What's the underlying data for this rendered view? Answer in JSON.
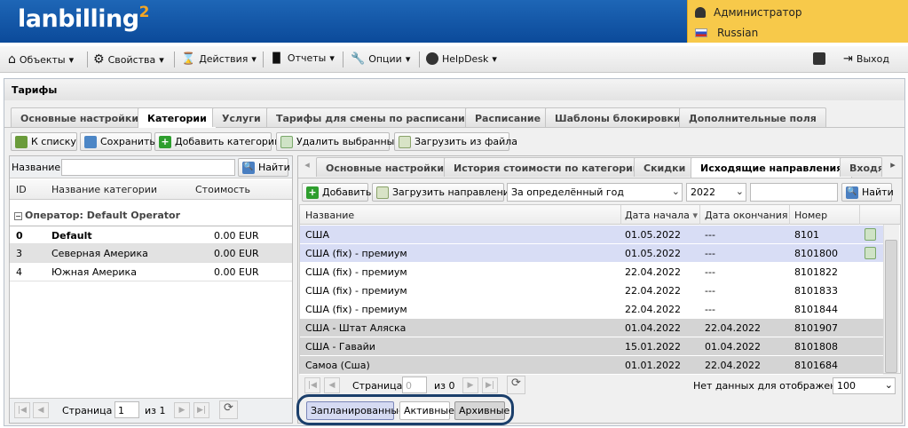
{
  "header": {
    "logo": "lanbilling",
    "logo_sup": "2",
    "user": "Администратор",
    "language": "Russian"
  },
  "menu": {
    "items": [
      "Объекты",
      "Свойства",
      "Действия",
      "Отчеты",
      "Опции",
      "HelpDesk"
    ],
    "logout": "Выход"
  },
  "page": {
    "title": "Тарифы"
  },
  "main_tabs": [
    "Основные настройки",
    "Категории",
    "Услуги",
    "Тарифы для смены по расписанию",
    "Расписание",
    "Шаблоны блокировки",
    "Дополнительные поля"
  ],
  "toolbar": {
    "back": "К списку",
    "save": "Сохранить",
    "add_category": "Добавить категорию",
    "delete_selected": "Удалить выбранные",
    "load_file": "Загрузить из файла"
  },
  "left": {
    "name_label": "Название:",
    "find": "Найти",
    "columns": [
      "ID",
      "Название категории",
      "Стоимость"
    ],
    "group": "Оператор: Default Operator",
    "rows": [
      {
        "id": "0",
        "name": "Default",
        "cost": "0.00 EUR"
      },
      {
        "id": "3",
        "name": "Северная Америка",
        "cost": "0.00 EUR"
      },
      {
        "id": "4",
        "name": "Южная Америка",
        "cost": "0.00 EUR"
      }
    ],
    "pager": {
      "page_label": "Страница",
      "page": "1",
      "of": "из 1"
    }
  },
  "right": {
    "tabs": [
      "Основные настройки",
      "История стоимости по категории",
      "Скидки",
      "Исходящие направления",
      "Входящ"
    ],
    "toolbar": {
      "add": "Добавить",
      "load": "Загрузить направления",
      "period": "За определённый год",
      "year": "2022",
      "find": "Найти"
    },
    "columns": [
      "Название",
      "Дата начала",
      "Дата окончания",
      "Номер"
    ],
    "rows": [
      {
        "name": "США",
        "start": "01.05.2022",
        "end": "---",
        "num": "8101"
      },
      {
        "name": "США (fix) - премиум",
        "start": "01.05.2022",
        "end": "---",
        "num": "8101800"
      },
      {
        "name": "США (fix) - премиум",
        "start": "22.04.2022",
        "end": "---",
        "num": "8101822"
      },
      {
        "name": "США (fix) - премиум",
        "start": "22.04.2022",
        "end": "---",
        "num": "8101833"
      },
      {
        "name": "США (fix) - премиум",
        "start": "22.04.2022",
        "end": "---",
        "num": "8101844"
      },
      {
        "name": "США - Штат Аляска",
        "start": "01.04.2022",
        "end": "22.04.2022",
        "num": "8101907"
      },
      {
        "name": "США - Гавайи",
        "start": "15.01.2022",
        "end": "01.04.2022",
        "num": "8101808"
      },
      {
        "name": "Самоа (Сша)",
        "start": "01.01.2022",
        "end": "22.04.2022",
        "num": "8101684"
      }
    ],
    "pager": {
      "page_label": "Страница",
      "page": "0",
      "of": "из 0",
      "no_data": "Нет данных для отображения",
      "page_size": "100"
    },
    "filters": [
      "Запланированные",
      "Активные",
      "Архивные"
    ]
  }
}
